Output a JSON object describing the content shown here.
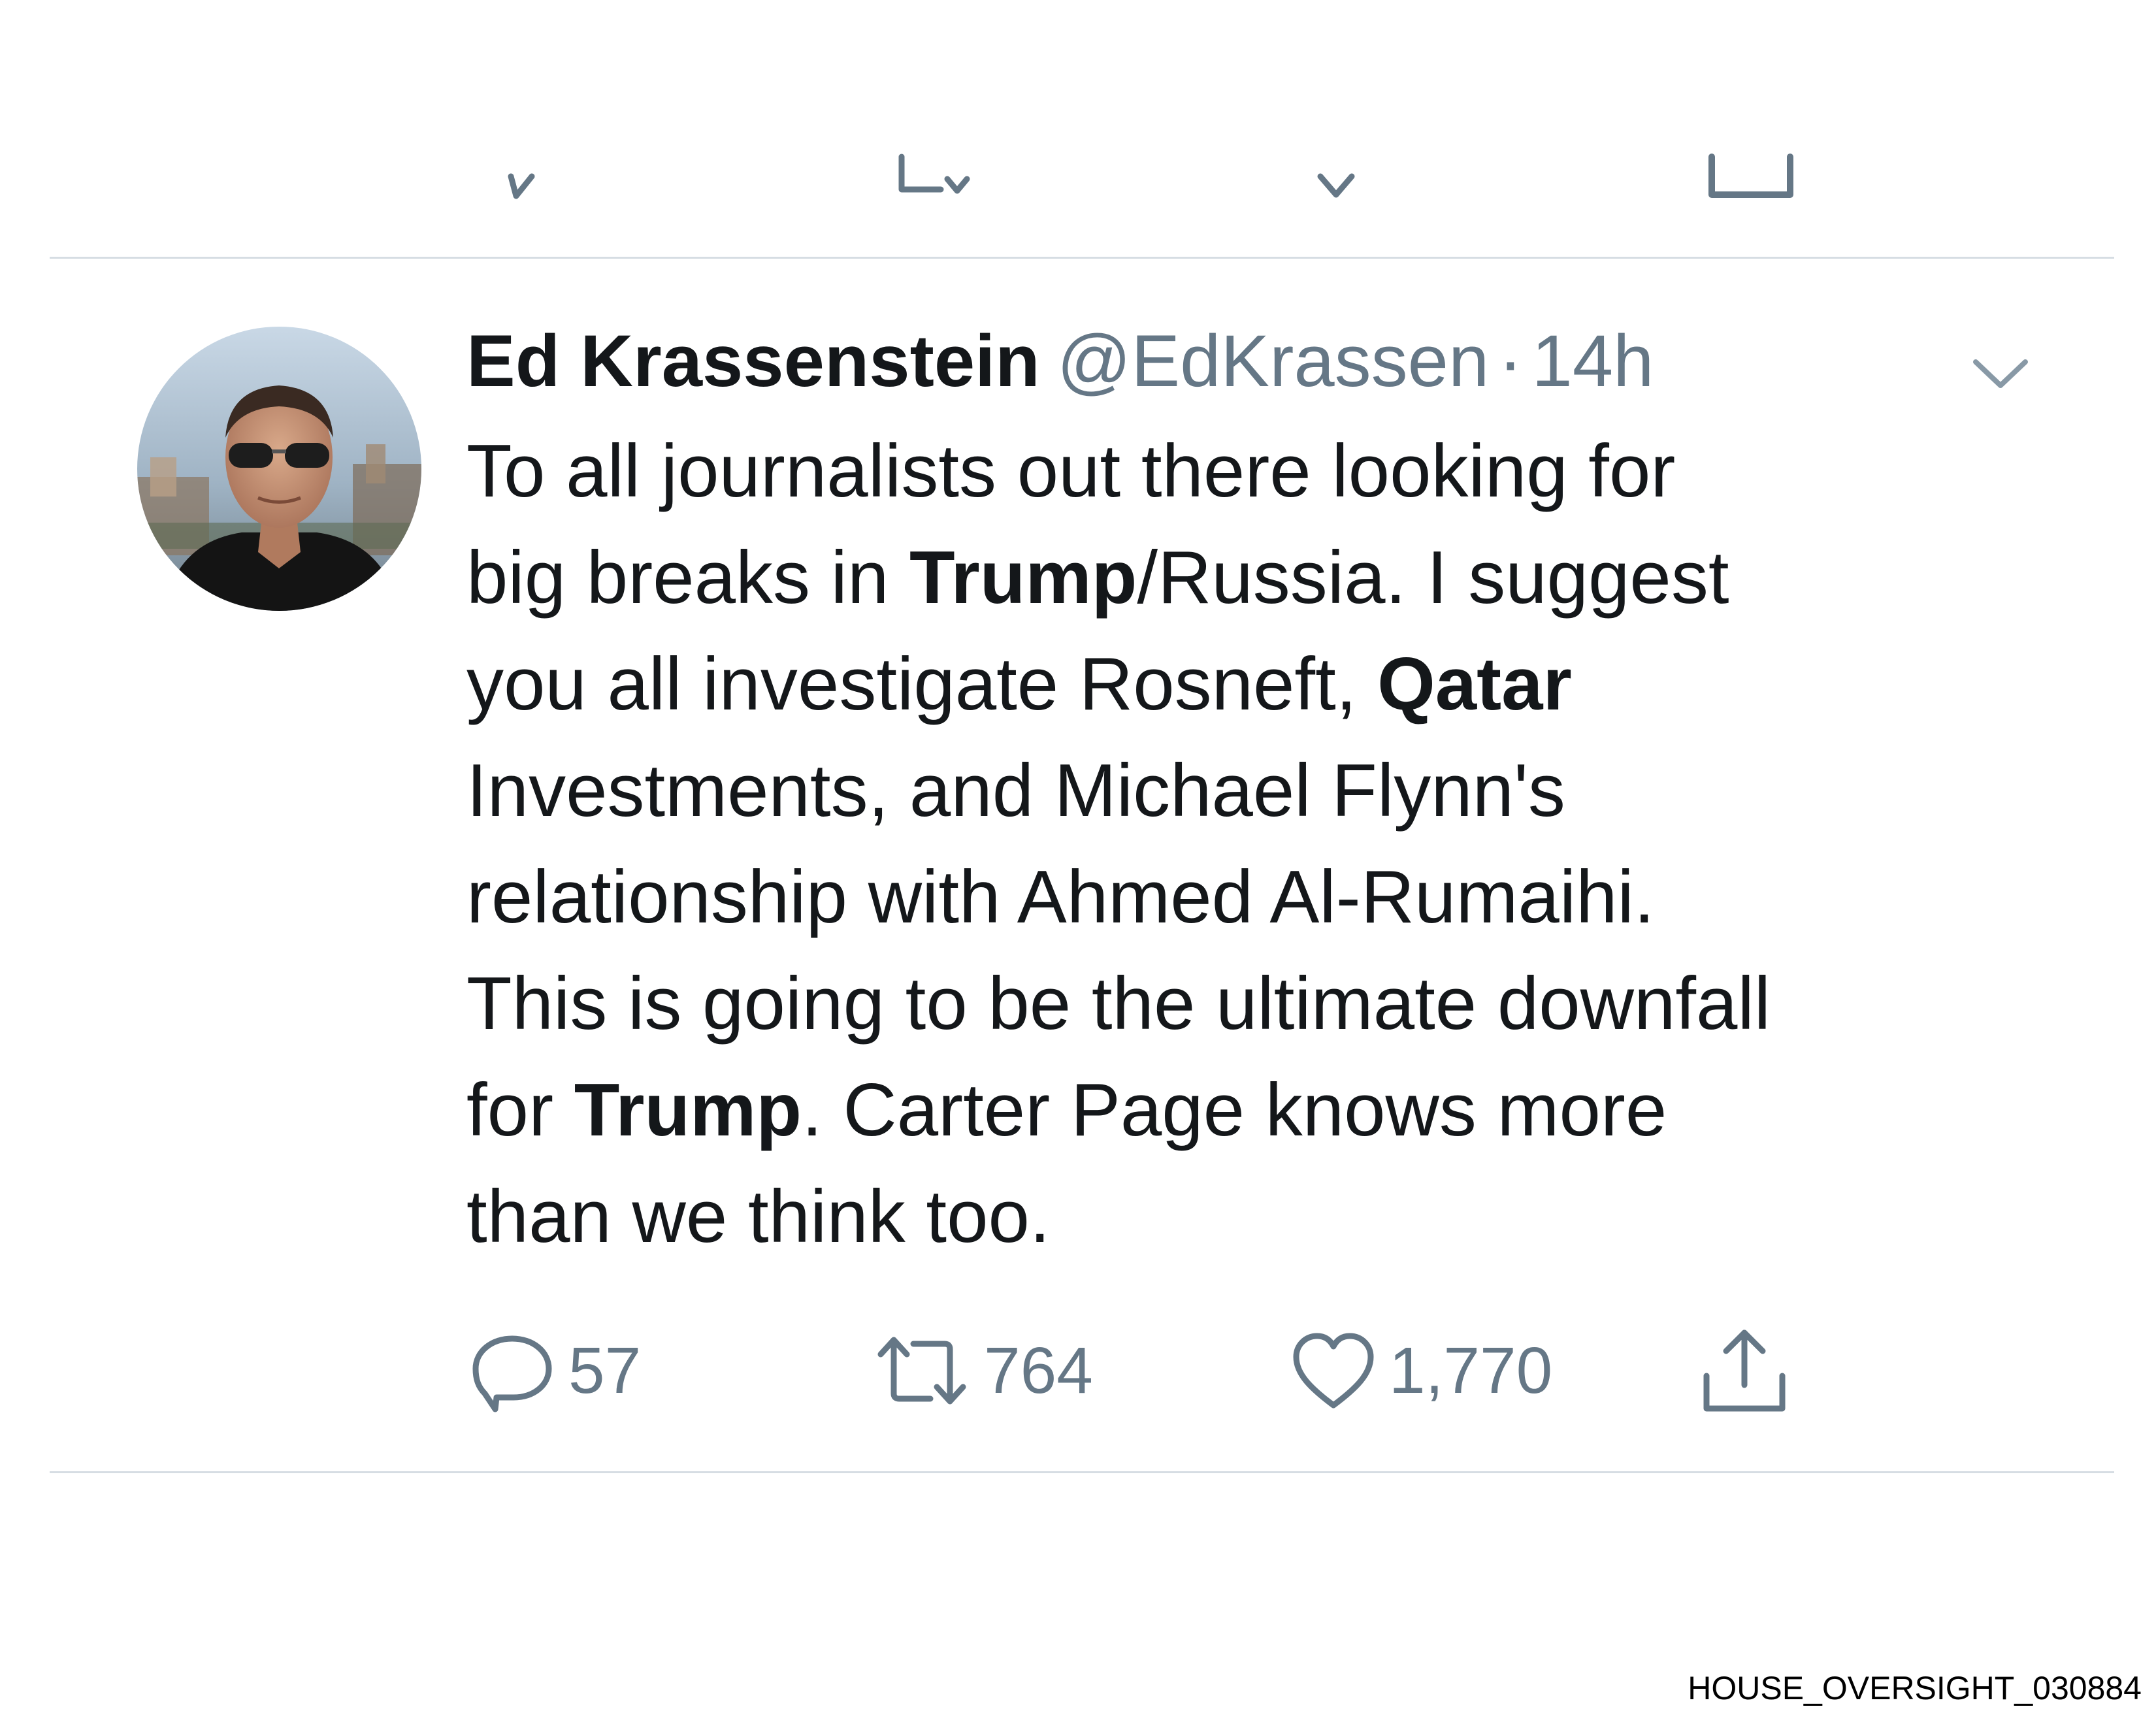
{
  "tweet": {
    "display_name": "Ed Krassenstein",
    "handle": "@EdKrassen",
    "separator": "·",
    "time": "14h",
    "text_lines": [
      [
        {
          "t": "To all journalists out there looking for",
          "b": false
        }
      ],
      [
        {
          "t": "big breaks in ",
          "b": false
        },
        {
          "t": "Trump",
          "b": true
        },
        {
          "t": "/Russia.  I suggest",
          "b": false
        }
      ],
      [
        {
          "t": "you all investigate Rosneft, ",
          "b": false
        },
        {
          "t": "Qatar",
          "b": true
        }
      ],
      [
        {
          "t": "Investments, and Michael Flynn's",
          "b": false
        }
      ],
      [
        {
          "t": "relationship with Ahmed Al-Rumaihi.",
          "b": false
        }
      ],
      [
        {
          "t": "This is going to be the ultimate downfall",
          "b": false
        }
      ],
      [
        {
          "t": "for ",
          "b": false
        },
        {
          "t": "Trump",
          "b": true
        },
        {
          "t": ". Carter Page knows more",
          "b": false
        }
      ],
      [
        {
          "t": "than we think too.",
          "b": false
        }
      ]
    ]
  },
  "actions": {
    "reply_icon": "reply-icon",
    "reply_count": "57",
    "retweet_icon": "retweet-icon",
    "retweet_count": "764",
    "like_icon": "heart-icon",
    "like_count": "1,770",
    "share_icon": "share-icon"
  },
  "menu_icon": "chevron-down-icon",
  "footer": {
    "label": "HOUSE_OVERSIGHT_030884"
  },
  "colors": {
    "text": "#14171a",
    "secondary": "#657786",
    "divider": "#d6dde3"
  }
}
